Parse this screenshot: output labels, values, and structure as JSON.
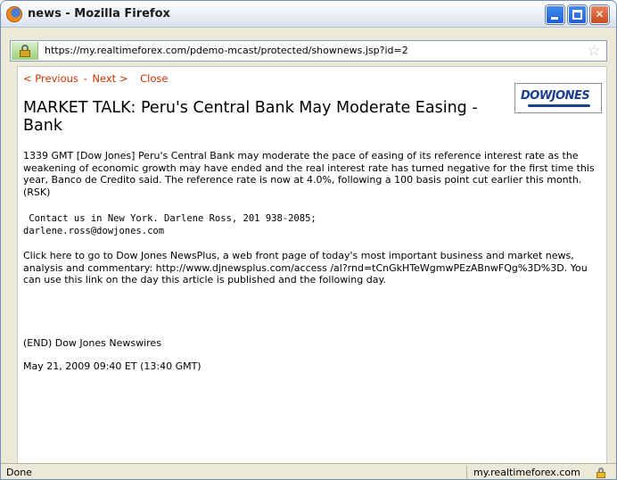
{
  "window": {
    "title": "news - Mozilla Firefox"
  },
  "urlbar": {
    "url": "https://my.realtimeforex.com/pdemo-mcast/protected/shownews.jsp?id=2"
  },
  "nav": {
    "previous": "< Previous",
    "separator": "-",
    "next": "Next >",
    "close": "Close"
  },
  "article": {
    "headline": "MARKET TALK: Peru's Central Bank May Moderate Easing - Bank",
    "logo_text": "DOWJONES",
    "body": "1339 GMT [Dow Jones] Peru's Central Bank may moderate the pace of easing of its reference interest rate as the weakening of economic growth may have ended and the real interest rate has turned negative for the first time this year, Banco de Credito said. The reference rate is now at 4.0%, following a 100 basis point cut earlier this month. (RSK)",
    "contact_line1": " Contact us in New York. Darlene Ross, 201 938-2085;",
    "contact_line2": "darlene.ross@dowjones.com",
    "newsplus": "Click here to go to Dow Jones NewsPlus, a web front page of today's most important business and market news, analysis and commentary: http://www.djnewsplus.com/access /al?rnd=tCnGkHTeWgmwPEzABnwFQg%3D%3D. You can use this link on the day this article is published and the following day.",
    "end": "(END) Dow Jones Newswires",
    "timestamp": "May 21, 2009 09:40 ET (13:40 GMT)"
  },
  "status": {
    "left": "Done",
    "right": "my.realtimeforex.com"
  },
  "colors": {
    "link": "#cc3300",
    "logo": "#1b3f8f"
  }
}
